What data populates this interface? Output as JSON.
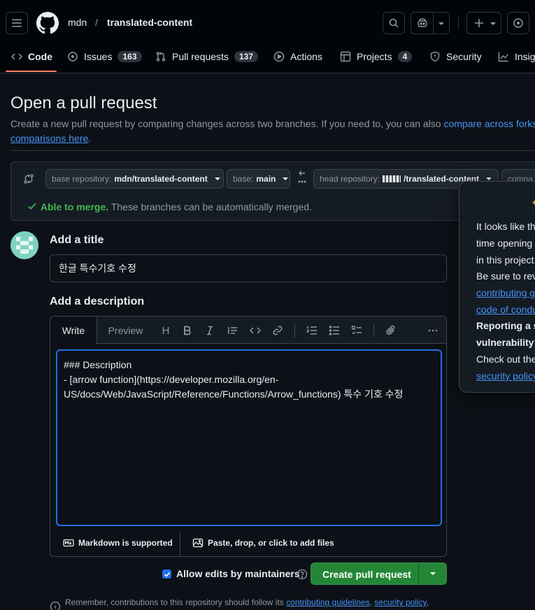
{
  "header": {
    "owner": "mdn",
    "separator": "/",
    "repo": "translated-content"
  },
  "nav": {
    "tabs": [
      {
        "label": "Code",
        "count": ""
      },
      {
        "label": "Issues",
        "count": "163"
      },
      {
        "label": "Pull requests",
        "count": "137"
      },
      {
        "label": "Actions",
        "count": ""
      },
      {
        "label": "Projects",
        "count": "4"
      },
      {
        "label": "Security",
        "count": ""
      },
      {
        "label": "Insig",
        "count": ""
      }
    ]
  },
  "page": {
    "title": "Open a pull request",
    "subtitle_text": "Create a new pull request by comparing changes across two branches. If you need to, you can also ",
    "subtitle_link1": "compare across forks.",
    "subtitle_link2": "comparisons here",
    "subtitle_end": "."
  },
  "compare": {
    "base_repo_label": "base repository:",
    "base_repo_value": "mdn/translated-content",
    "base_label": "base:",
    "base_value": "main",
    "head_repo_label": "head repository:",
    "head_repo_value": "/translated-content",
    "compare_label": "compa",
    "merge_ok": "Able to merge.",
    "merge_text": " These branches can be automatically merged."
  },
  "form": {
    "title_label": "Add a title",
    "title_value": "한글 특수기호 수정",
    "description_label": "Add a description",
    "write_tab": "Write",
    "preview_tab": "Preview",
    "heading_tool": "H",
    "body": "### Description\n- [arrow function](https://developer.mozilla.org/en-US/docs/Web/JavaScript/Reference/Functions/Arrow_functions) 특수 기호 수정",
    "markdown_note": "Markdown is supported",
    "attach_note": "Paste, drop, or click to add files",
    "allow_edits": "Allow edits by maintainers",
    "create_button": "Create pull request"
  },
  "footer": {
    "remember": "Remember, contributions to this repository should follow its",
    "link1": "contributing guidelines",
    "link2": "security policy",
    "comma": ",",
    "comma2": ","
  },
  "popover": {
    "line1": "It looks like th",
    "line2": "time opening",
    "line3": "in this project",
    "line4": "Be sure to rev",
    "link1": "contributing g",
    "link2": "code of condu",
    "bold1": "Reporting a s",
    "bold2": "vulnerability?",
    "line5": "Check out the",
    "link3": "security policy"
  },
  "colors": {
    "accent": "#f78166",
    "link": "#4493f8",
    "success": "#3fb950",
    "primary_button": "#238636"
  }
}
